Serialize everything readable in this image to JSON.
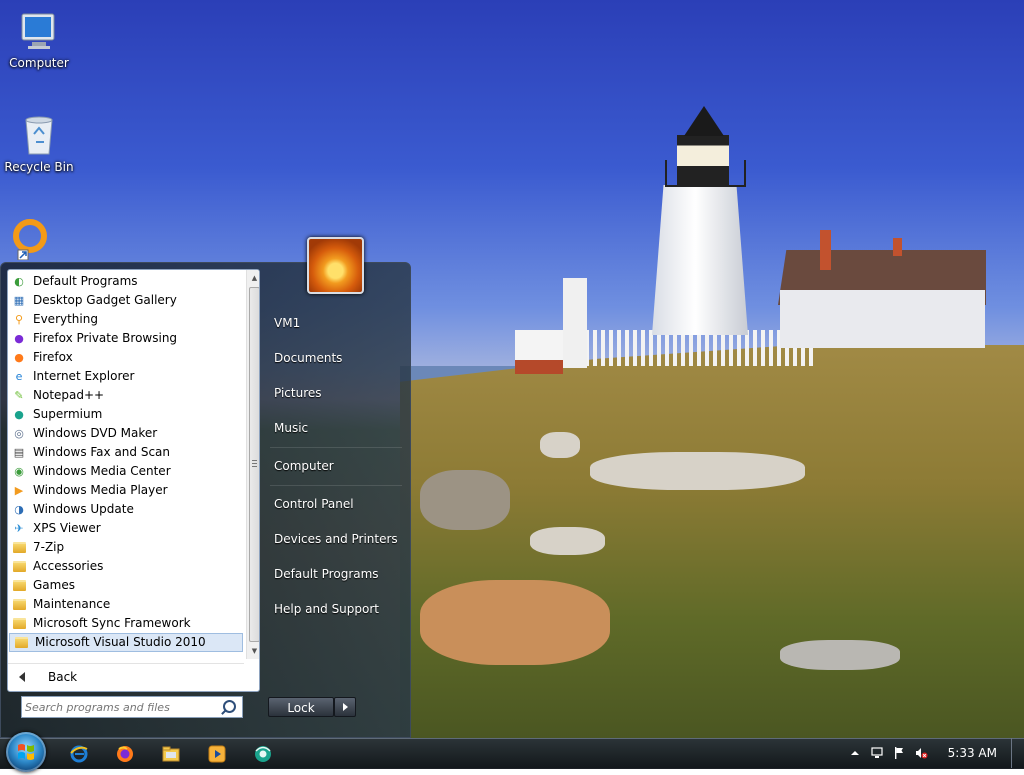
{
  "desktop": {
    "icons": [
      {
        "label": "Computer",
        "icon": "computer-icon"
      },
      {
        "label": "Recycle Bin",
        "icon": "recycle-bin-icon"
      },
      {
        "label": "",
        "icon": "everything-shortcut-icon"
      }
    ]
  },
  "start_menu": {
    "programs": [
      {
        "label": "Default Programs",
        "icon": "default-programs-icon"
      },
      {
        "label": "Desktop Gadget Gallery",
        "icon": "gadget-gallery-icon"
      },
      {
        "label": "Everything",
        "icon": "everything-search-icon"
      },
      {
        "label": "Firefox Private Browsing",
        "icon": "firefox-private-icon"
      },
      {
        "label": "Firefox",
        "icon": "firefox-icon"
      },
      {
        "label": "Internet Explorer",
        "icon": "internet-explorer-icon"
      },
      {
        "label": "Notepad++",
        "icon": "notepad-plus-plus-icon"
      },
      {
        "label": "Supermium",
        "icon": "supermium-icon"
      },
      {
        "label": "Windows DVD Maker",
        "icon": "dvd-maker-icon"
      },
      {
        "label": "Windows Fax and Scan",
        "icon": "fax-scan-icon"
      },
      {
        "label": "Windows Media Center",
        "icon": "media-center-icon"
      },
      {
        "label": "Windows Media Player",
        "icon": "media-player-icon"
      },
      {
        "label": "Windows Update",
        "icon": "windows-update-icon"
      },
      {
        "label": "XPS Viewer",
        "icon": "xps-viewer-icon"
      },
      {
        "label": "7-Zip",
        "icon": "folder-icon"
      },
      {
        "label": "Accessories",
        "icon": "folder-icon"
      },
      {
        "label": "Games",
        "icon": "folder-icon"
      },
      {
        "label": "Maintenance",
        "icon": "folder-icon"
      },
      {
        "label": "Microsoft Sync Framework",
        "icon": "folder-icon"
      },
      {
        "label": "Microsoft Visual Studio 2010",
        "icon": "folder-icon",
        "selected": true
      }
    ],
    "back_label": "Back",
    "search_placeholder": "Search programs and files",
    "right_pane": {
      "user": "VM1",
      "documents": "Documents",
      "pictures": "Pictures",
      "music": "Music",
      "computer": "Computer",
      "control_panel": "Control Panel",
      "devices_printers": "Devices and Printers",
      "default_programs": "Default Programs",
      "help_support": "Help and Support"
    },
    "lock_label": "Lock"
  },
  "taskbar": {
    "pinned": [
      "internet-explorer-icon",
      "firefox-icon",
      "windows-explorer-icon",
      "media-player-icon",
      "supermium-icon"
    ],
    "tray_icons": [
      "show-hidden-icons-icon",
      "network-icon",
      "action-center-flag-icon",
      "volume-muted-icon"
    ],
    "clock": "5:33 AM"
  },
  "colors": {
    "selection": "#dbe7f6",
    "taskbar": "#1b222b",
    "start_menu_right": "#2e3a47"
  }
}
